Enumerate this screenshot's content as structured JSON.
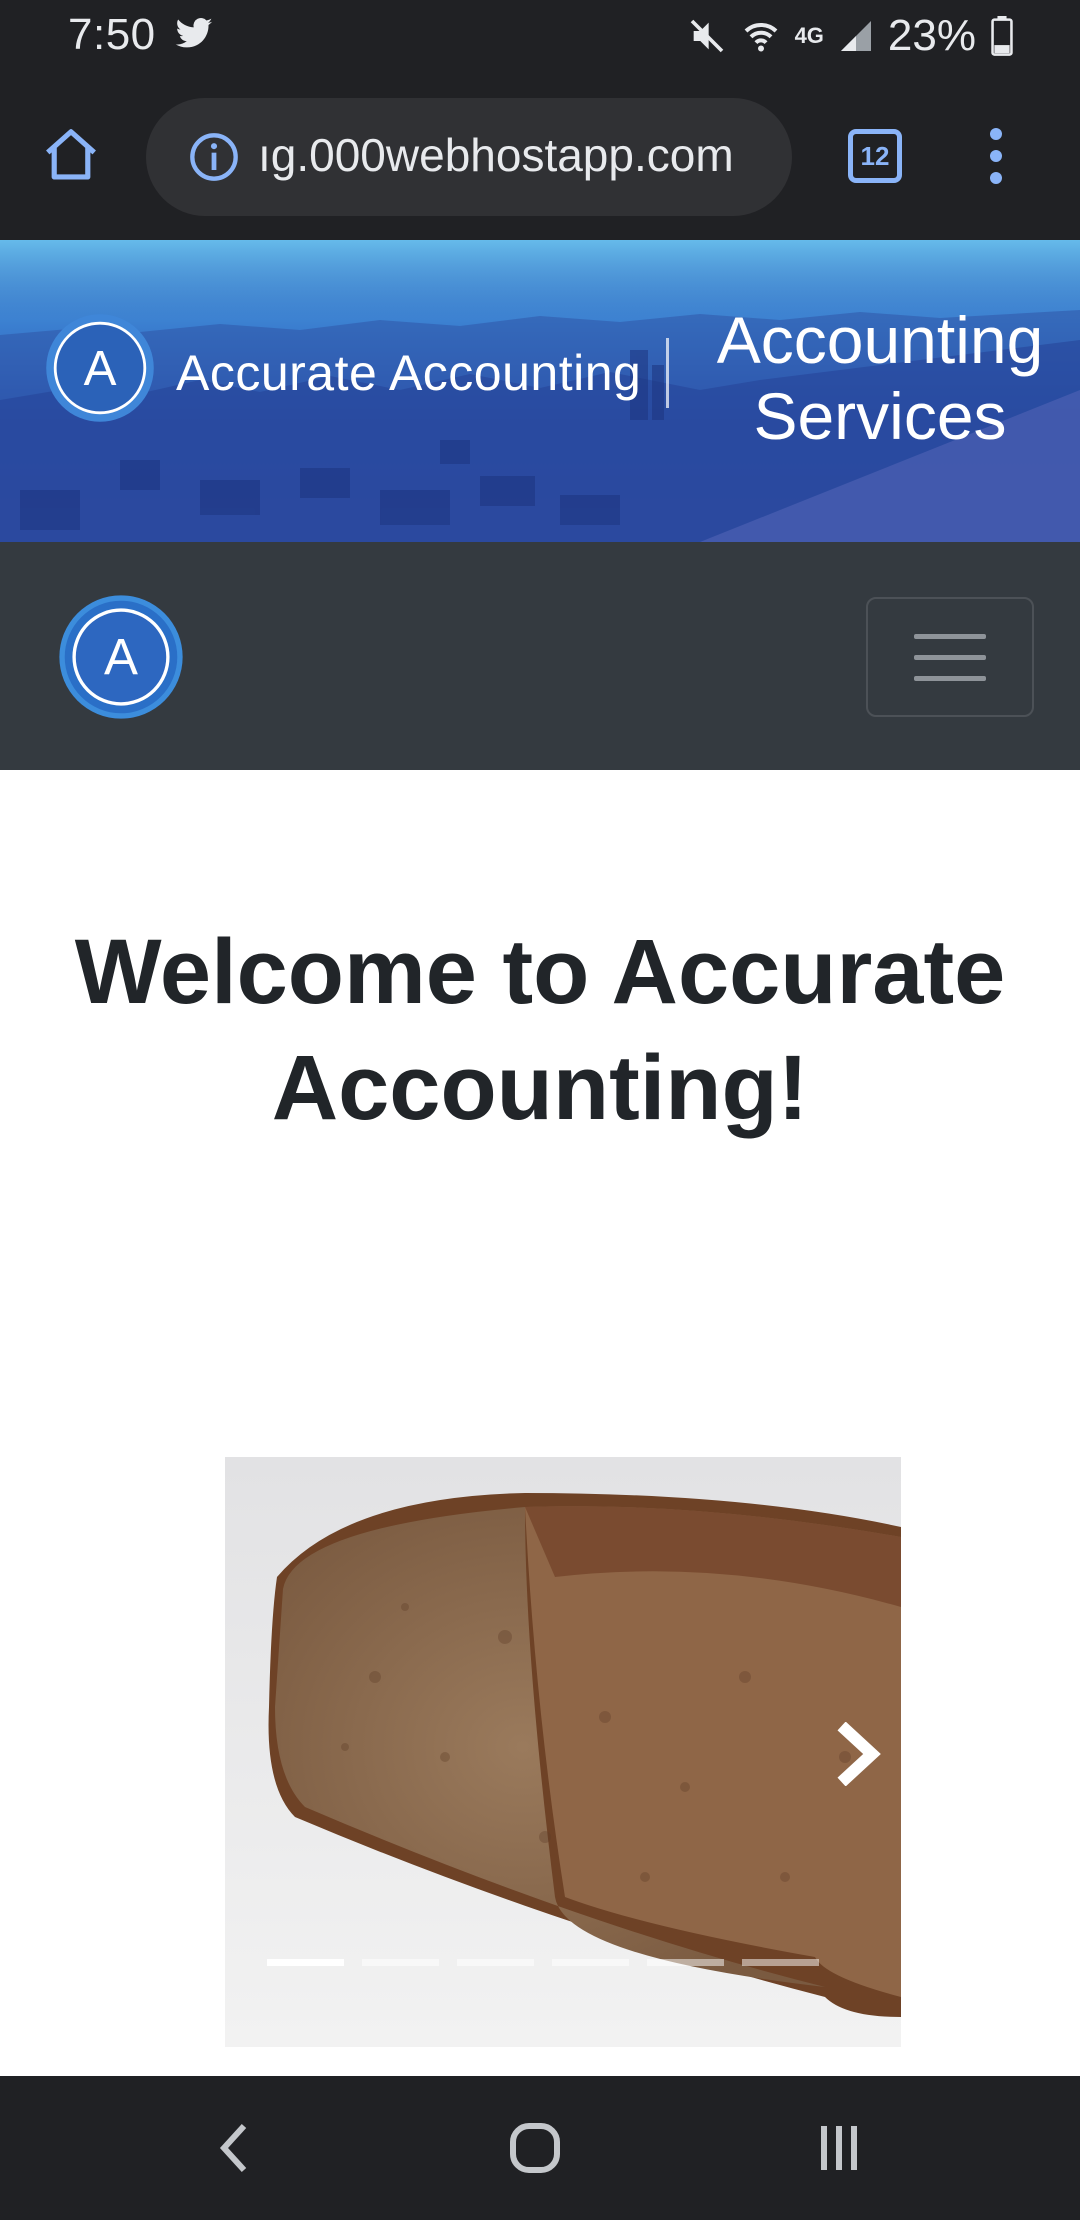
{
  "status_bar": {
    "time": "7:50",
    "network": "4G",
    "battery": "23%",
    "icons": [
      "twitter-icon",
      "mute-icon",
      "wifi-icon",
      "signal-icon",
      "battery-icon"
    ]
  },
  "browser": {
    "url": "ıg.000webhostapp.com",
    "tab_count": "12",
    "icons": [
      "home-icon",
      "info-icon",
      "tabs-icon",
      "more-vert-icon"
    ],
    "accent_color": "#8ab4f8"
  },
  "banner": {
    "brand_letter": "A",
    "brand": "Accurate Accounting",
    "tagline_line1": "Accounting",
    "tagline_line2": "Services"
  },
  "navbar": {
    "logo_letter": "A",
    "toggler_icon": "hamburger-icon",
    "background_color": "#343a40"
  },
  "main": {
    "heading": "Welcome to Accurate Accounting!"
  },
  "carousel": {
    "image_subject": "loaf of bread",
    "slide_count": 6,
    "active_index": 0,
    "next_icon": "chevron-right-icon"
  },
  "system_nav": {
    "icons": [
      "back-icon",
      "home-circle-icon",
      "recents-icon"
    ]
  }
}
